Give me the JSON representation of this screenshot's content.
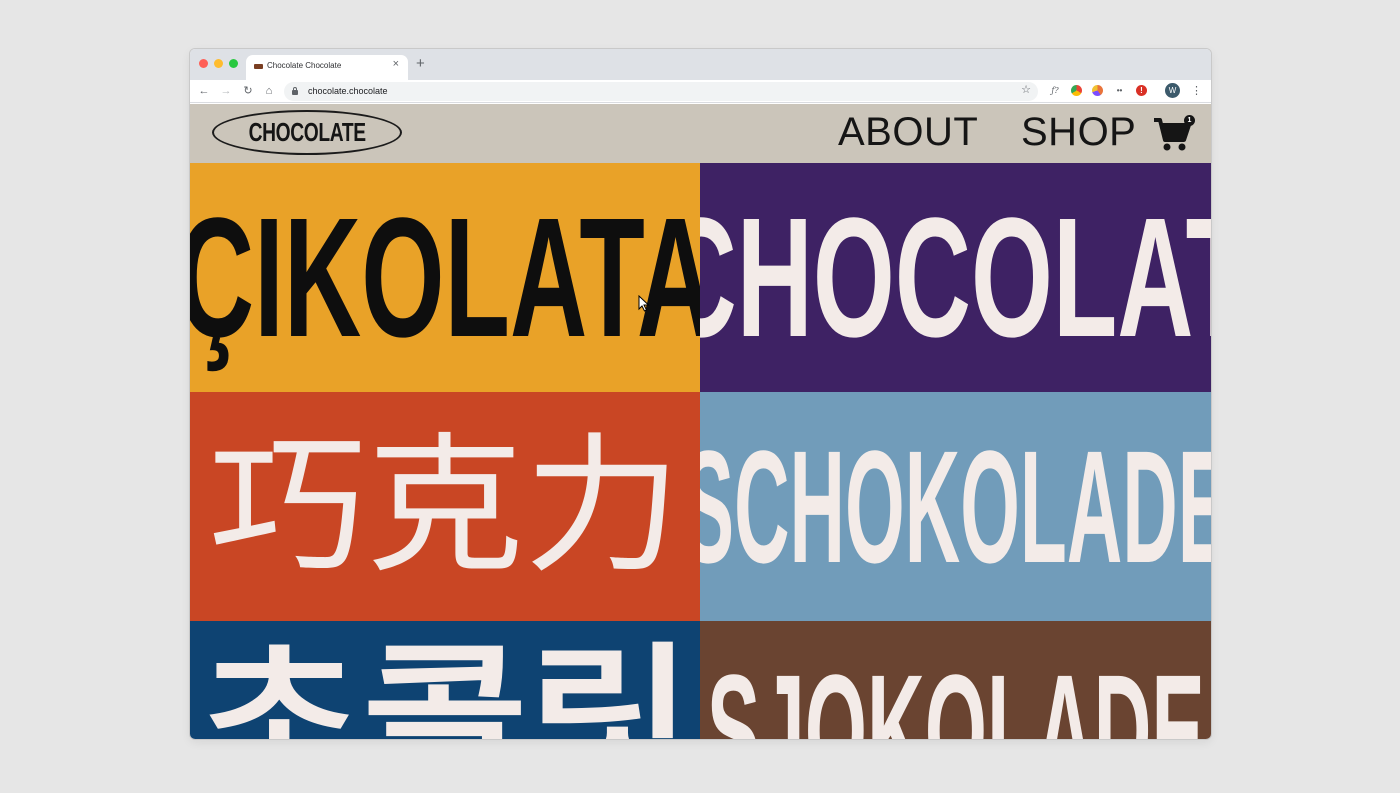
{
  "browser": {
    "tab_title": "Chocolate Chocolate",
    "tab_close": "×",
    "new_tab": "+",
    "url": "chocolate.chocolate",
    "nav": {
      "back": "←",
      "forward": "→",
      "reload": "↻",
      "home": "⌂"
    },
    "star": "☆",
    "extensions": {
      "fx": "ƒ?",
      "dots": "••",
      "stop": "!"
    },
    "avatar_initial": "W",
    "menu": "⋮"
  },
  "site": {
    "logo": "CHOCOLATE",
    "nav": {
      "about": "ABOUT",
      "shop": "SHOP"
    },
    "cart_count": "1"
  },
  "tiles": [
    {
      "word": "ÇIKOLATA",
      "bg": "#e9a228",
      "color": "#0e0e0e"
    },
    {
      "word": "CHOCOLAT",
      "bg": "#3e2264",
      "color": "#f3ebe8"
    },
    {
      "word": "巧克力",
      "bg": "#c94624",
      "color": "#f3ebe8"
    },
    {
      "word": "SCHOKOLADE",
      "bg": "#719cba",
      "color": "#f3ebe8"
    },
    {
      "word": "초콜릿",
      "bg": "#0e4372",
      "color": "#f3ebe8"
    },
    {
      "word": "SJOKOLADE",
      "bg": "#6a4431",
      "color": "#f3ebe8"
    }
  ],
  "colors": {
    "header_bg": "#cbc5ba",
    "desktop_bg": "#e6e6e6"
  }
}
